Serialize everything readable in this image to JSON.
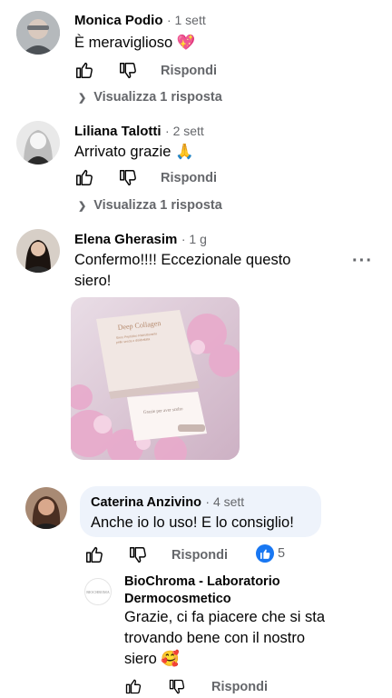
{
  "comments": [
    {
      "author": "Monica Podio",
      "time": "· 1 sett",
      "text": "È meraviglioso ",
      "emoji": "heart-sparkle",
      "reply_label": "Rispondi",
      "view_replies": "Visualizza 1 risposta"
    },
    {
      "author": "Liliana Talotti",
      "time": "· 2 sett",
      "text": "Arrivato grazie ",
      "emoji": "folded-hands",
      "reply_label": "Rispondi",
      "view_replies": "Visualizza 1 risposta"
    },
    {
      "author": "Elena Gherasim",
      "time": "· 1 g",
      "text_line1": "Confermo!!!! Eccezionale questo",
      "text_line2": "siero!",
      "more": "···",
      "photo_text": {
        "box_title": "Deep Collagen",
        "box_sub1": "Siero Peptidico Ristrutturante",
        "box_sub2": "pelle secca e disidratata",
        "card": "Grazie per aver scelto"
      }
    },
    {
      "author": "Caterina Anzivino",
      "time": "· 4 sett",
      "text": "Anche io lo uso! E lo consiglio!",
      "reply_label": "Rispondi",
      "like_count": "5"
    }
  ],
  "reply": {
    "author_line1": "BioChroma - Laboratorio",
    "author_line2": "Dermocosmetico",
    "text_line1": "Grazie, ci fa piacere che si sta",
    "text_line2": "trovando bene con il nostro",
    "text_line3": "siero ",
    "emoji": "smiling-face-hearts",
    "reply_label": "Rispondi",
    "logo_text": "BIOCHROMA"
  },
  "colors": {
    "secondary_text": "#65676b",
    "primary_text": "#050505",
    "like_blue": "#1877f2",
    "bubble_bg": "#eef3fb"
  }
}
